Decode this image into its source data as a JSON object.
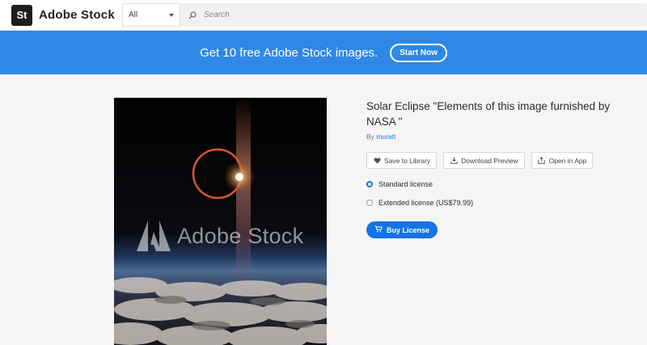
{
  "header": {
    "logo_text": "St",
    "brand": "Adobe Stock",
    "filter": {
      "value": "All"
    },
    "search": {
      "placeholder": "Search"
    }
  },
  "banner": {
    "text": "Get 10 free Adobe Stock images.",
    "button": "Start Now",
    "color": "#2f88e6"
  },
  "asset": {
    "watermark": "Adobe Stock",
    "title": "Solar Eclipse \"Elements of this image furnished by NASA \"",
    "by_label": "By",
    "author": "muratt"
  },
  "actions": [
    {
      "label": "Save to Library",
      "icon": "heart-icon"
    },
    {
      "label": "Download Preview",
      "icon": "download-icon"
    },
    {
      "label": "Open in App",
      "icon": "open-in-app-icon"
    }
  ],
  "licenses": [
    {
      "label": "Standard license",
      "selected": true
    },
    {
      "label": "Extended license (US$79.99)",
      "selected": false
    }
  ],
  "buy": {
    "label": "Buy License",
    "icon": "cart-icon"
  },
  "colors": {
    "accent": "#1473e6",
    "banner": "#2f88e6"
  }
}
